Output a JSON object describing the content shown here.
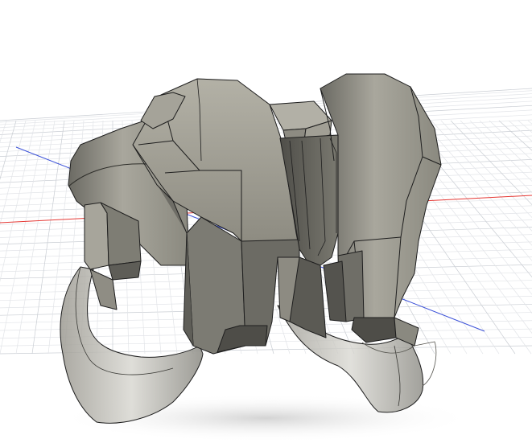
{
  "viewport": {
    "background": "#ffffff",
    "grid_color": "#c9cdd3",
    "grid_minor_color": "#e2e4e8",
    "x_axis_color": "#e53935",
    "y_axis_color": "#3a50d8"
  },
  "model": {
    "base_color": "#8e8d85",
    "light_color": "#b9b7ad",
    "dark_color": "#5e5d57",
    "edge_color": "#1e1e1e",
    "shadow_color": "#dcdcdc"
  }
}
